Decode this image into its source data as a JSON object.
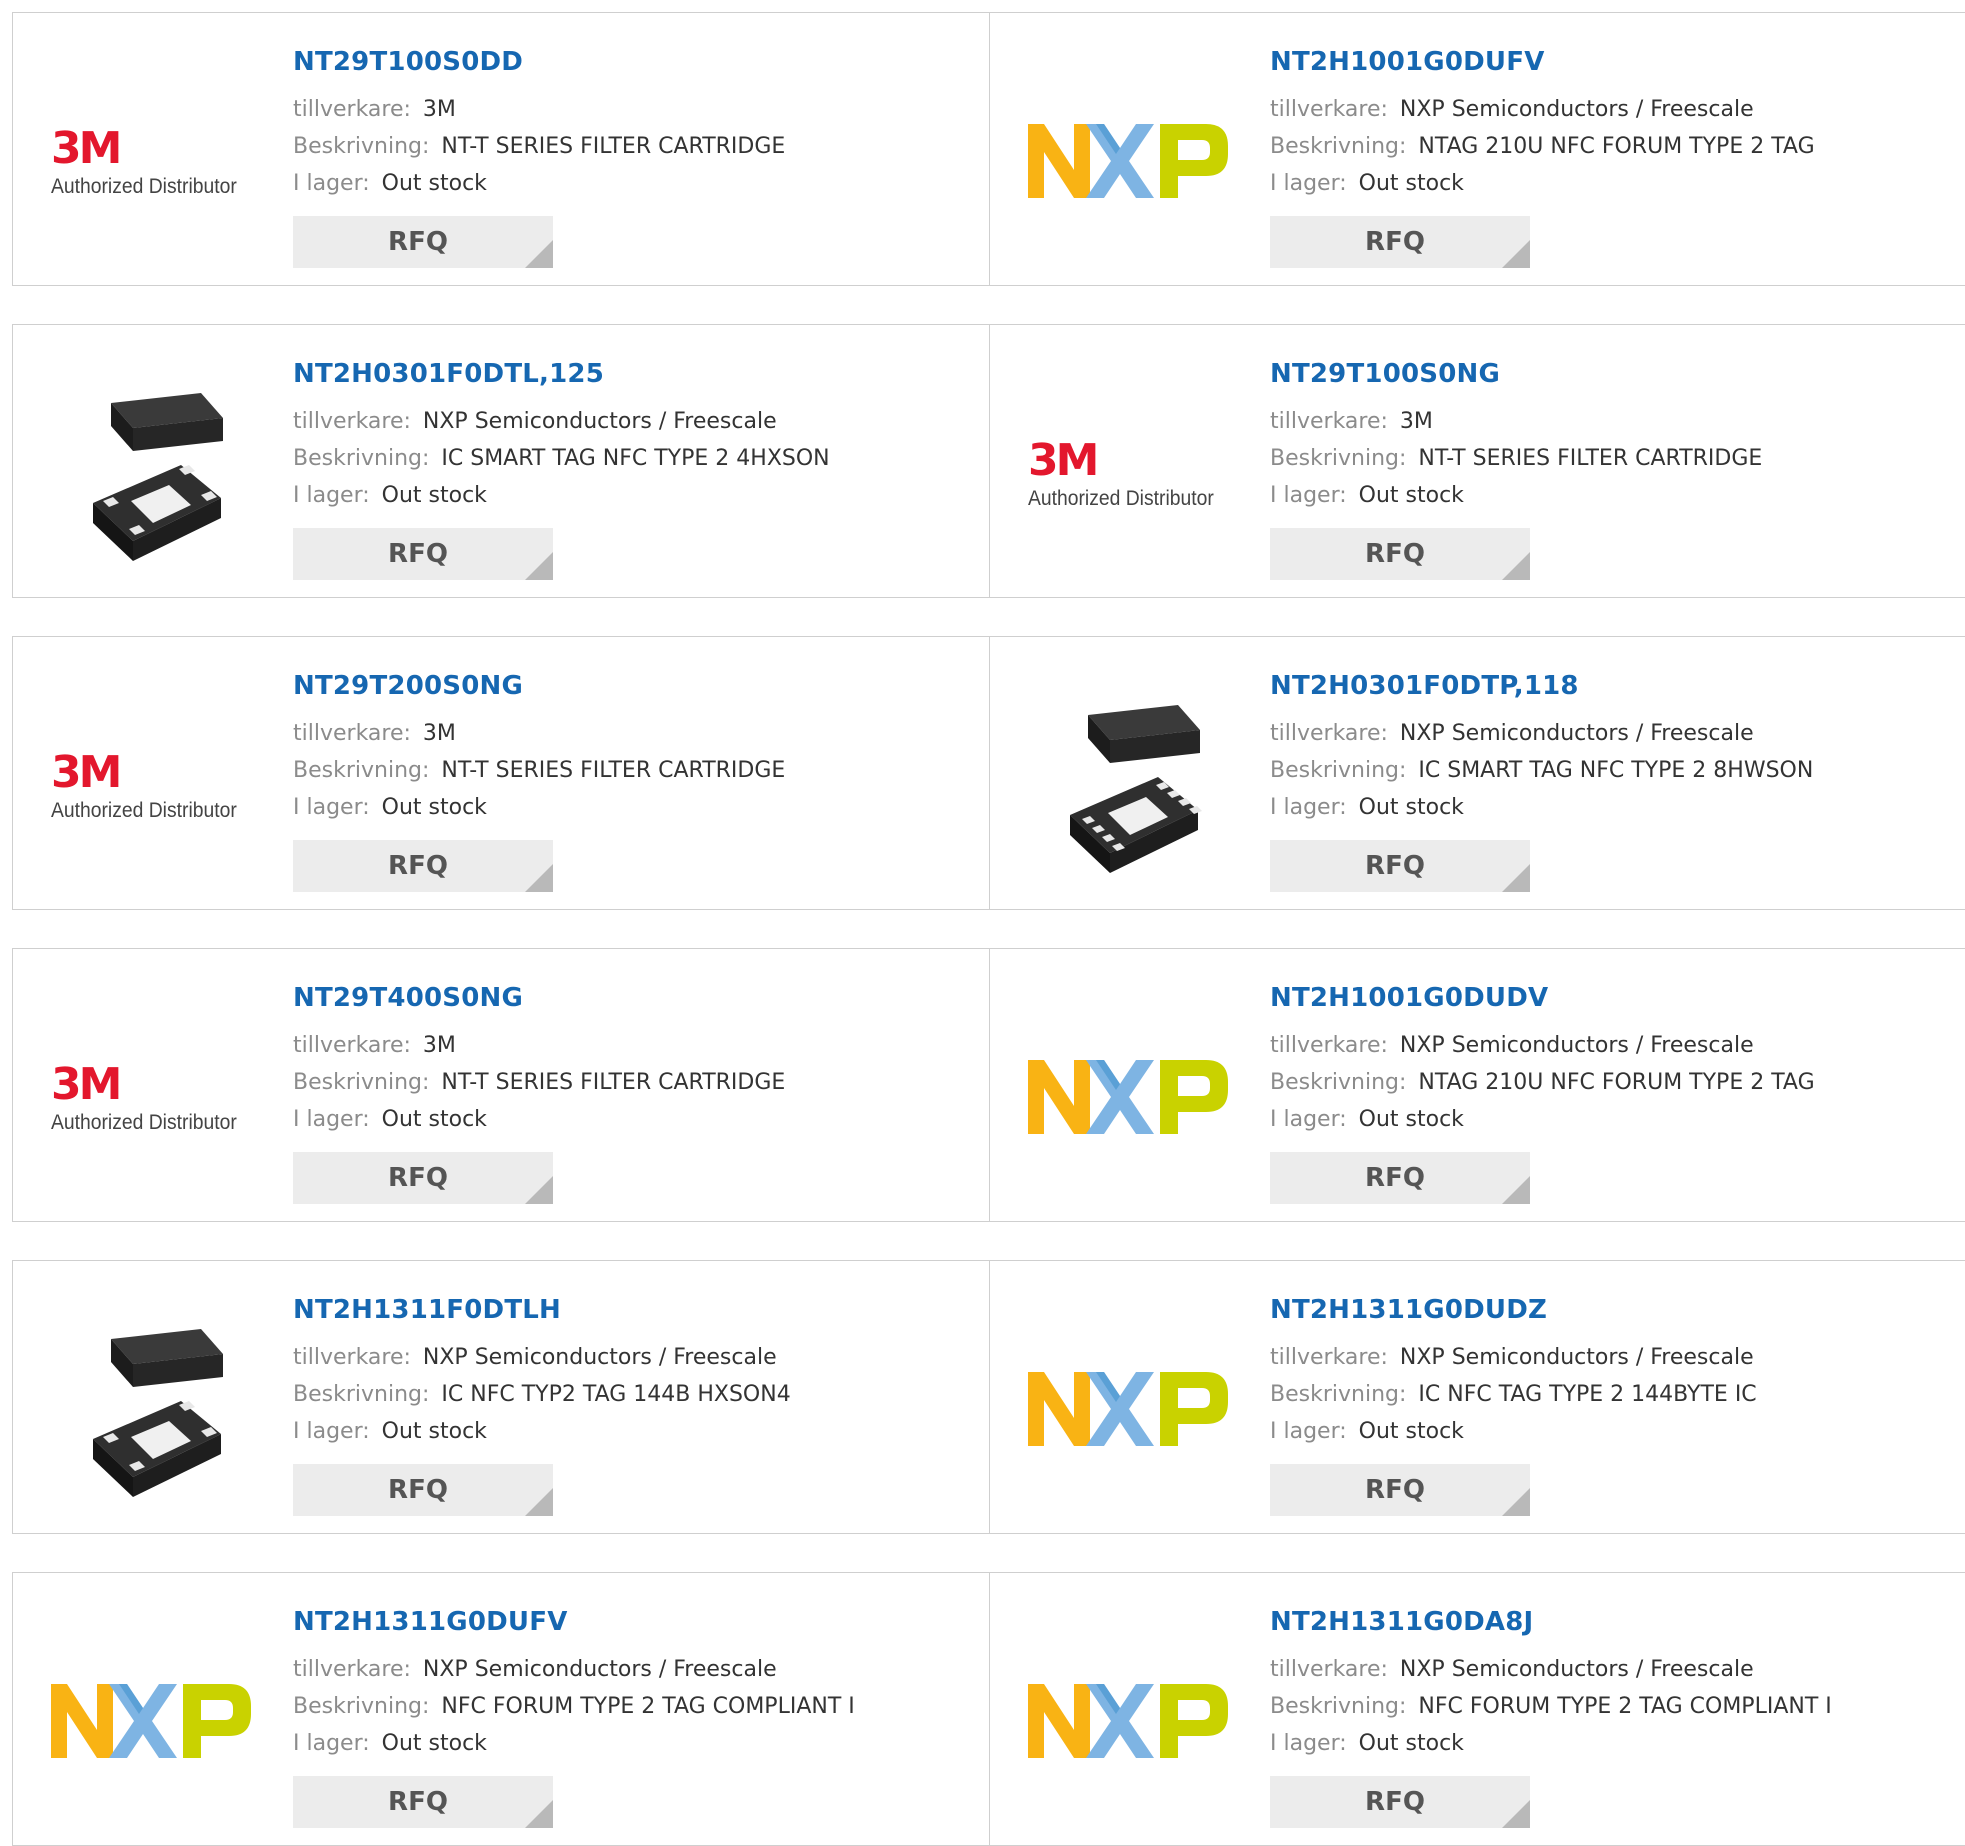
{
  "labels": {
    "manufacturer": "tillverkare:",
    "description": "Beskrivning:",
    "stock": "I lager:",
    "rfq": "RFQ"
  },
  "logos": {
    "three_m": {
      "mark": "3M",
      "subtitle": "Authorized Distributor"
    },
    "nxp_colors": [
      "#f9b314",
      "#7eb4e3",
      "#c9d200"
    ],
    "three_m_color": "#e3172d"
  },
  "accent_color": "#1667b1",
  "products": [
    {
      "part": "NT29T100S0DD",
      "manufacturer": "3M",
      "description": "NT-T SERIES FILTER CARTRIDGE",
      "stock": "Out stock",
      "image": "3m-logo"
    },
    {
      "part": "NT2H1001G0DUFV",
      "manufacturer": "NXP Semiconductors / Freescale",
      "description": "NTAG 210U NFC FORUM TYPE 2 TAG",
      "stock": "Out stock",
      "image": "nxp-logo"
    },
    {
      "part": "NT2H0301F0DTL,125",
      "manufacturer": "NXP Semiconductors / Freescale",
      "description": "IC SMART TAG NFC TYPE 2 4HXSON",
      "stock": "Out stock",
      "image": "chip-4pin"
    },
    {
      "part": "NT29T100S0NG",
      "manufacturer": "3M",
      "description": "NT-T SERIES FILTER CARTRIDGE",
      "stock": "Out stock",
      "image": "3m-logo"
    },
    {
      "part": "NT29T200S0NG",
      "manufacturer": "3M",
      "description": "NT-T SERIES FILTER CARTRIDGE",
      "stock": "Out stock",
      "image": "3m-logo"
    },
    {
      "part": "NT2H0301F0DTP,118",
      "manufacturer": "NXP Semiconductors / Freescale",
      "description": "IC SMART TAG NFC TYPE 2 8HWSON",
      "stock": "Out stock",
      "image": "chip-8pin"
    },
    {
      "part": "NT29T400S0NG",
      "manufacturer": "3M",
      "description": "NT-T SERIES FILTER CARTRIDGE",
      "stock": "Out stock",
      "image": "3m-logo"
    },
    {
      "part": "NT2H1001G0DUDV",
      "manufacturer": "NXP Semiconductors / Freescale",
      "description": "NTAG 210U NFC FORUM TYPE 2 TAG",
      "stock": "Out stock",
      "image": "nxp-logo"
    },
    {
      "part": "NT2H1311F0DTLH",
      "manufacturer": "NXP Semiconductors / Freescale",
      "description": "IC NFC TYP2 TAG 144B HXSON4",
      "stock": "Out stock",
      "image": "chip-4pin"
    },
    {
      "part": "NT2H1311G0DUDZ",
      "manufacturer": "NXP Semiconductors / Freescale",
      "description": "IC NFC TAG TYPE 2 144BYTE IC",
      "stock": "Out stock",
      "image": "nxp-logo"
    },
    {
      "part": "NT2H1311G0DUFV",
      "manufacturer": "NXP Semiconductors / Freescale",
      "description": "NFC FORUM TYPE 2 TAG COMPLIANT I",
      "stock": "Out stock",
      "image": "nxp-logo"
    },
    {
      "part": "NT2H1311G0DA8J",
      "manufacturer": "NXP Semiconductors / Freescale",
      "description": "NFC FORUM TYPE 2 TAG COMPLIANT I",
      "stock": "Out stock",
      "image": "nxp-logo"
    }
  ]
}
